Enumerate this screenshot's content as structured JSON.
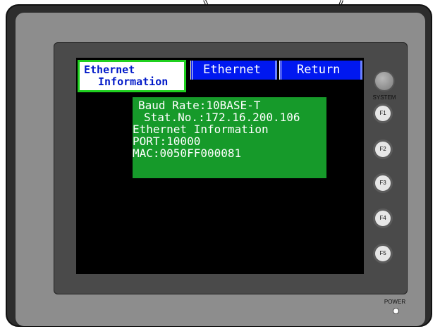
{
  "title_tab": {
    "line1": "Ethernet",
    "line2": "Information"
  },
  "tabs": [
    {
      "label": "Ethernet"
    },
    {
      "label": "Return"
    }
  ],
  "info_panel": {
    "baud_rate": "Baud Rate:10BASE-T",
    "station_no": "Stat.No.:172.16.200.106",
    "heading": "Ethernet Information",
    "port": "PORT:10000",
    "mac": "MAC:0050FF000081"
  },
  "side_keys": {
    "system_label": "SYSTEM",
    "function_keys": [
      "F1",
      "F2",
      "F3",
      "F4",
      "F5"
    ]
  },
  "power_label": "POWER",
  "colors": {
    "screen": "#000000",
    "tab_blue": "#0018f0",
    "panel_green": "#169a2a",
    "title_border_green": "#1fd01f",
    "title_text_blue": "#0018c8"
  }
}
